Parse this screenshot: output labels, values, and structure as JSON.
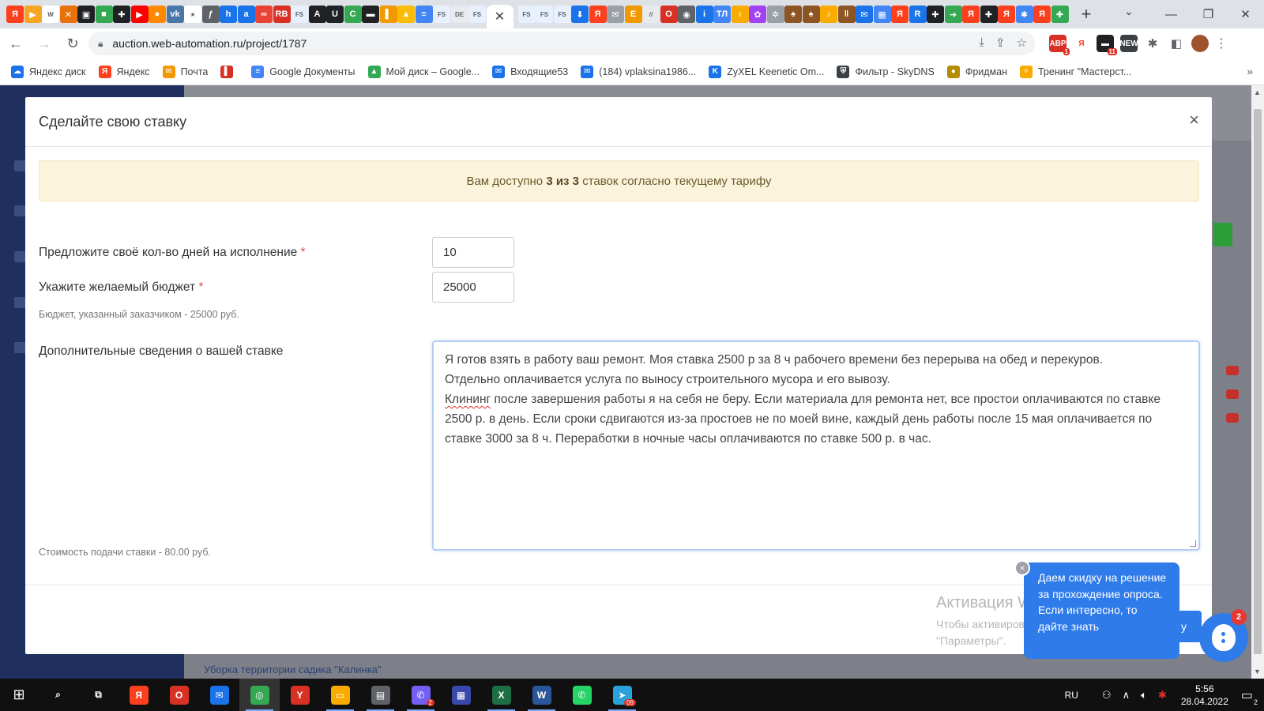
{
  "browser": {
    "tab_favicons": [
      {
        "name": "yandex-tab-icon",
        "glyph": "Я",
        "color": "#fc3f1d"
      },
      {
        "name": "play-tab-icon",
        "glyph": "▶",
        "color": "#f5a623"
      },
      {
        "name": "wikipedia-tab-icon",
        "glyph": "W",
        "color": "#ffffff"
      },
      {
        "name": "x-tab-icon",
        "glyph": "✕",
        "color": "#e8710a"
      },
      {
        "name": "dark-tab-icon",
        "glyph": "▣",
        "color": "#202124"
      },
      {
        "name": "green-tab-icon",
        "glyph": "■",
        "color": "#34a853"
      },
      {
        "name": "plus-circle-tab-icon",
        "glyph": "✚",
        "color": "#202124"
      },
      {
        "name": "youtube-tab-icon",
        "glyph": "▶",
        "color": "#ff0000"
      },
      {
        "name": "orange-dot-tab-icon",
        "glyph": "●",
        "color": "#ff8a00"
      },
      {
        "name": "vk-tab-icon",
        "glyph": "vk",
        "color": "#4a76a8"
      },
      {
        "name": "star-tab-icon",
        "glyph": "★",
        "color": "#ffffff"
      },
      {
        "name": "f-tab-icon",
        "glyph": "ƒ",
        "color": "#5f6368"
      },
      {
        "name": "h-tab-icon",
        "glyph": "h",
        "color": "#1a73e8"
      },
      {
        "name": "at-tab-icon",
        "glyph": "a",
        "color": "#1a73e8"
      },
      {
        "name": "infinity-tab-icon",
        "glyph": "∞",
        "color": "#ea4335"
      },
      {
        "name": "rb-tab-icon",
        "glyph": "RB",
        "color": "#d93025"
      },
      {
        "name": "fs-tab-icon",
        "glyph": "FS",
        "color": "#e8f0fe"
      },
      {
        "name": "a-tab-icon",
        "glyph": "A",
        "color": "#202124"
      },
      {
        "name": "u-tab-icon",
        "glyph": "U",
        "color": "#202124"
      },
      {
        "name": "c-tab-icon",
        "glyph": "C",
        "color": "#34a853"
      },
      {
        "name": "bw-tab-icon",
        "glyph": "▬",
        "color": "#202124"
      },
      {
        "name": "chart-tab-icon",
        "glyph": "▌",
        "color": "#f29900"
      },
      {
        "name": "image-tab-icon",
        "glyph": "▲",
        "color": "#fbbc04"
      },
      {
        "name": "doc-tab-icon",
        "glyph": "≡",
        "color": "#4285f4"
      },
      {
        "name": "fs-tab-icon-2",
        "glyph": "FS",
        "color": "#e8f0fe"
      },
      {
        "name": "de-tab-icon",
        "glyph": "DE",
        "color": "#e8eaed"
      },
      {
        "name": "fs-tab-icon-3",
        "glyph": "FS",
        "color": "#e8f0fe"
      }
    ],
    "tab_favicons_right": [
      {
        "name": "fs-tab-icon-4",
        "glyph": "FS",
        "color": "#e8f0fe"
      },
      {
        "name": "fs-tab-icon-5",
        "glyph": "FS",
        "color": "#e8f0fe"
      },
      {
        "name": "fs-tab-icon-6",
        "glyph": "FS",
        "color": "#e8f0fe"
      },
      {
        "name": "download-tab-icon",
        "glyph": "⬇",
        "color": "#1a73e8"
      },
      {
        "name": "yandex-tab-icon-2",
        "glyph": "Я",
        "color": "#fc3f1d"
      },
      {
        "name": "msg-tab-icon",
        "glyph": "✉",
        "color": "#9aa0a6"
      },
      {
        "name": "e-tab-icon",
        "glyph": "E",
        "color": "#f29900"
      },
      {
        "name": "slash-tab-icon",
        "glyph": "//",
        "color": "#e8eaed"
      },
      {
        "name": "opera-tab-icon",
        "glyph": "O",
        "color": "#d93025"
      },
      {
        "name": "wifi-tab-icon",
        "glyph": "◉",
        "color": "#5f6368"
      },
      {
        "name": "i-tab-icon",
        "glyph": "i",
        "color": "#1a73e8"
      },
      {
        "name": "tl-tab-icon",
        "glyph": "ТЛ",
        "color": "#4285f4"
      },
      {
        "name": "bird-tab-icon",
        "glyph": "♪",
        "color": "#f9ab00"
      },
      {
        "name": "flower-tab-icon",
        "glyph": "✿",
        "color": "#a142f4"
      },
      {
        "name": "snow-tab-icon",
        "glyph": "✲",
        "color": "#9aa0a6"
      },
      {
        "name": "bird-tab-icon-2",
        "glyph": "♠",
        "color": "#8d5524"
      },
      {
        "name": "bird-tab-icon-3",
        "glyph": "♠",
        "color": "#8d5524"
      },
      {
        "name": "bird-tab-icon-4",
        "glyph": "♪",
        "color": "#f9ab00"
      },
      {
        "name": "bar-tab-icon",
        "glyph": "‖",
        "color": "#8d5524"
      },
      {
        "name": "mail-tab-icon",
        "glyph": "✉",
        "color": "#1a73e8"
      },
      {
        "name": "grid-tab-icon",
        "glyph": "▦",
        "color": "#4285f4"
      },
      {
        "name": "yandex-tab-icon-3",
        "glyph": "Я",
        "color": "#fc3f1d"
      },
      {
        "name": "r-tab-icon",
        "glyph": "R",
        "color": "#1a73e8"
      },
      {
        "name": "plus-tab-icon",
        "glyph": "✚",
        "color": "#202124"
      },
      {
        "name": "arrow-tab-icon",
        "glyph": "➜",
        "color": "#34a853"
      },
      {
        "name": "yandex-tab-icon-4",
        "glyph": "Я",
        "color": "#fc3f1d"
      },
      {
        "name": "plus-tab-icon-2",
        "glyph": "✚",
        "color": "#202124"
      },
      {
        "name": "yandex-tab-icon-5",
        "glyph": "Я",
        "color": "#fc3f1d"
      },
      {
        "name": "gear-tab-icon",
        "glyph": "✱",
        "color": "#4285f4"
      },
      {
        "name": "yandex-tab-icon-6",
        "glyph": "Я",
        "color": "#fc3f1d"
      },
      {
        "name": "plus-box-tab-icon",
        "glyph": "✚",
        "color": "#34a853"
      }
    ],
    "active_tab_glyph": "✕",
    "new_tab_glyph": "+",
    "url": "auction.web-automation.ru/project/1787",
    "bookmarks": [
      {
        "label": "Яндекс диск",
        "icon": "yandex-disk-icon",
        "color": "#1a73e8",
        "glyph": "☁"
      },
      {
        "label": "Яндекс",
        "icon": "yandex-icon",
        "color": "#fc3f1d",
        "glyph": "Я"
      },
      {
        "label": "Почта",
        "icon": "mail-icon",
        "color": "#f29900",
        "glyph": "✉"
      },
      {
        "label": "",
        "icon": "bars-icon",
        "color": "#d93025",
        "glyph": "▌"
      },
      {
        "label": "Google Документы",
        "icon": "google-docs-icon",
        "color": "#4285f4",
        "glyph": "≡"
      },
      {
        "label": "Мой диск – Google...",
        "icon": "google-drive-icon",
        "color": "#34a853",
        "glyph": "▲"
      },
      {
        "label": "Входящие53",
        "icon": "inbox-icon",
        "color": "#1a73e8",
        "glyph": "✉"
      },
      {
        "label": "(184) vplaksina1986...",
        "icon": "inbox-icon-2",
        "color": "#1a73e8",
        "glyph": "✉"
      },
      {
        "label": "ZyXEL Keenetic Om...",
        "icon": "zyxel-icon",
        "color": "#1a73e8",
        "glyph": "K"
      },
      {
        "label": "Фильтр - SkyDNS",
        "icon": "shield-icon",
        "color": "#3c4043",
        "glyph": "⛨"
      },
      {
        "label": "Фридман",
        "icon": "fridman-icon",
        "color": "#b58b00",
        "glyph": "●"
      },
      {
        "label": "Тренинг \"Мастерст...",
        "icon": "training-icon",
        "color": "#f9ab00",
        "glyph": "✧"
      }
    ]
  },
  "modal": {
    "title": "Сделайте свою ставку",
    "close_glyph": "×",
    "alert_before": "Вам доступно ",
    "alert_bold": "3 из 3",
    "alert_after": " ставок согласно текущему тарифу",
    "days_label": "Предложите своё кол-во дней на исполнение",
    "days_value": "10",
    "budget_label": "Укажите желаемый бюджет",
    "budget_value": "25000",
    "required_mark": "*",
    "budget_hint": "Бюджет, указанный заказчиком - 25000 руб.",
    "details_label": "Дополнительные сведения о вашей ставке",
    "details_line1": "Я готов взять в работу ваш ремонт. Моя ставка 2500 р за 8 ч рабочего времени без перерыва на обед и перекуров.",
    "details_line2": "Отдельно оплачивается услуга по выносу строительного мусора и его вывозу.",
    "details_misspelled": "Клининг",
    "details_line3_rest": " после завершения работы я на себя не беру. Если материала для ремонта нет, все простои оплачиваются по ставке 2500 р. в день. Если сроки сдвигаются из-за простоев не по моей вине, каждый день работы после 15 мая оплачивается по ставке 3000 за 8 ч. Переработки в ночные часы оплачиваются по ставке 500 р. в час.",
    "cost_hint": "Стоимость подачи ставки - 80.00 руб."
  },
  "background_page": {
    "bottom_link": "Уборка территории садика \"Калинка\""
  },
  "watermark": {
    "title": "Активация Windows",
    "line1": "Чтобы активировать Windows, перейдите в раздел",
    "line2": "\"Параметры\"."
  },
  "chat": {
    "message": "Даем скидку на решение за прохождение опроса. Если интересно, то дайте знать",
    "badge": "2",
    "close_glyph": "×",
    "tab_glyph": "у"
  },
  "taskbar": {
    "apps": [
      {
        "name": "search-taskbar-icon",
        "glyph": "⌕",
        "color": "#101010",
        "open": false
      },
      {
        "name": "task-view-taskbar-icon",
        "glyph": "⧉",
        "color": "#101010",
        "open": false
      },
      {
        "name": "yandex-taskbar-icon",
        "glyph": "Я",
        "color": "#fc3f1d",
        "open": false
      },
      {
        "name": "opera-taskbar-icon",
        "glyph": "O",
        "color": "#d93025",
        "open": false
      },
      {
        "name": "mail-taskbar-icon",
        "glyph": "✉",
        "color": "#1a73e8",
        "open": false
      },
      {
        "name": "chrome-taskbar-icon",
        "glyph": "◎",
        "color": "#34a853",
        "open": true,
        "active": true
      },
      {
        "name": "yandex-browser-taskbar-icon",
        "glyph": "Y",
        "color": "#d93025",
        "open": false
      },
      {
        "name": "explorer-taskbar-icon",
        "glyph": "▭",
        "color": "#f9ab00",
        "open": true
      },
      {
        "name": "apps-taskbar-icon",
        "glyph": "▤",
        "color": "#5f6368",
        "open": true
      },
      {
        "name": "viber-taskbar-icon",
        "glyph": "✆",
        "color": "#7360f2",
        "open": true,
        "badge": "2"
      },
      {
        "name": "media-taskbar-icon",
        "glyph": "▦",
        "color": "#3949ab",
        "open": false
      },
      {
        "name": "excel-taskbar-icon",
        "glyph": "X",
        "color": "#1d6f42",
        "open": true
      },
      {
        "name": "word-taskbar-icon",
        "glyph": "W",
        "color": "#2b579a",
        "open": true
      },
      {
        "name": "whatsapp-taskbar-icon",
        "glyph": "✆",
        "color": "#25d366",
        "open": false
      },
      {
        "name": "telegram-taskbar-icon",
        "glyph": "➤",
        "color": "#2aa1da",
        "open": true,
        "badge": "09"
      }
    ],
    "lang": "RU",
    "time": "5:56",
    "date": "28.04.2022",
    "notifications": "2"
  }
}
